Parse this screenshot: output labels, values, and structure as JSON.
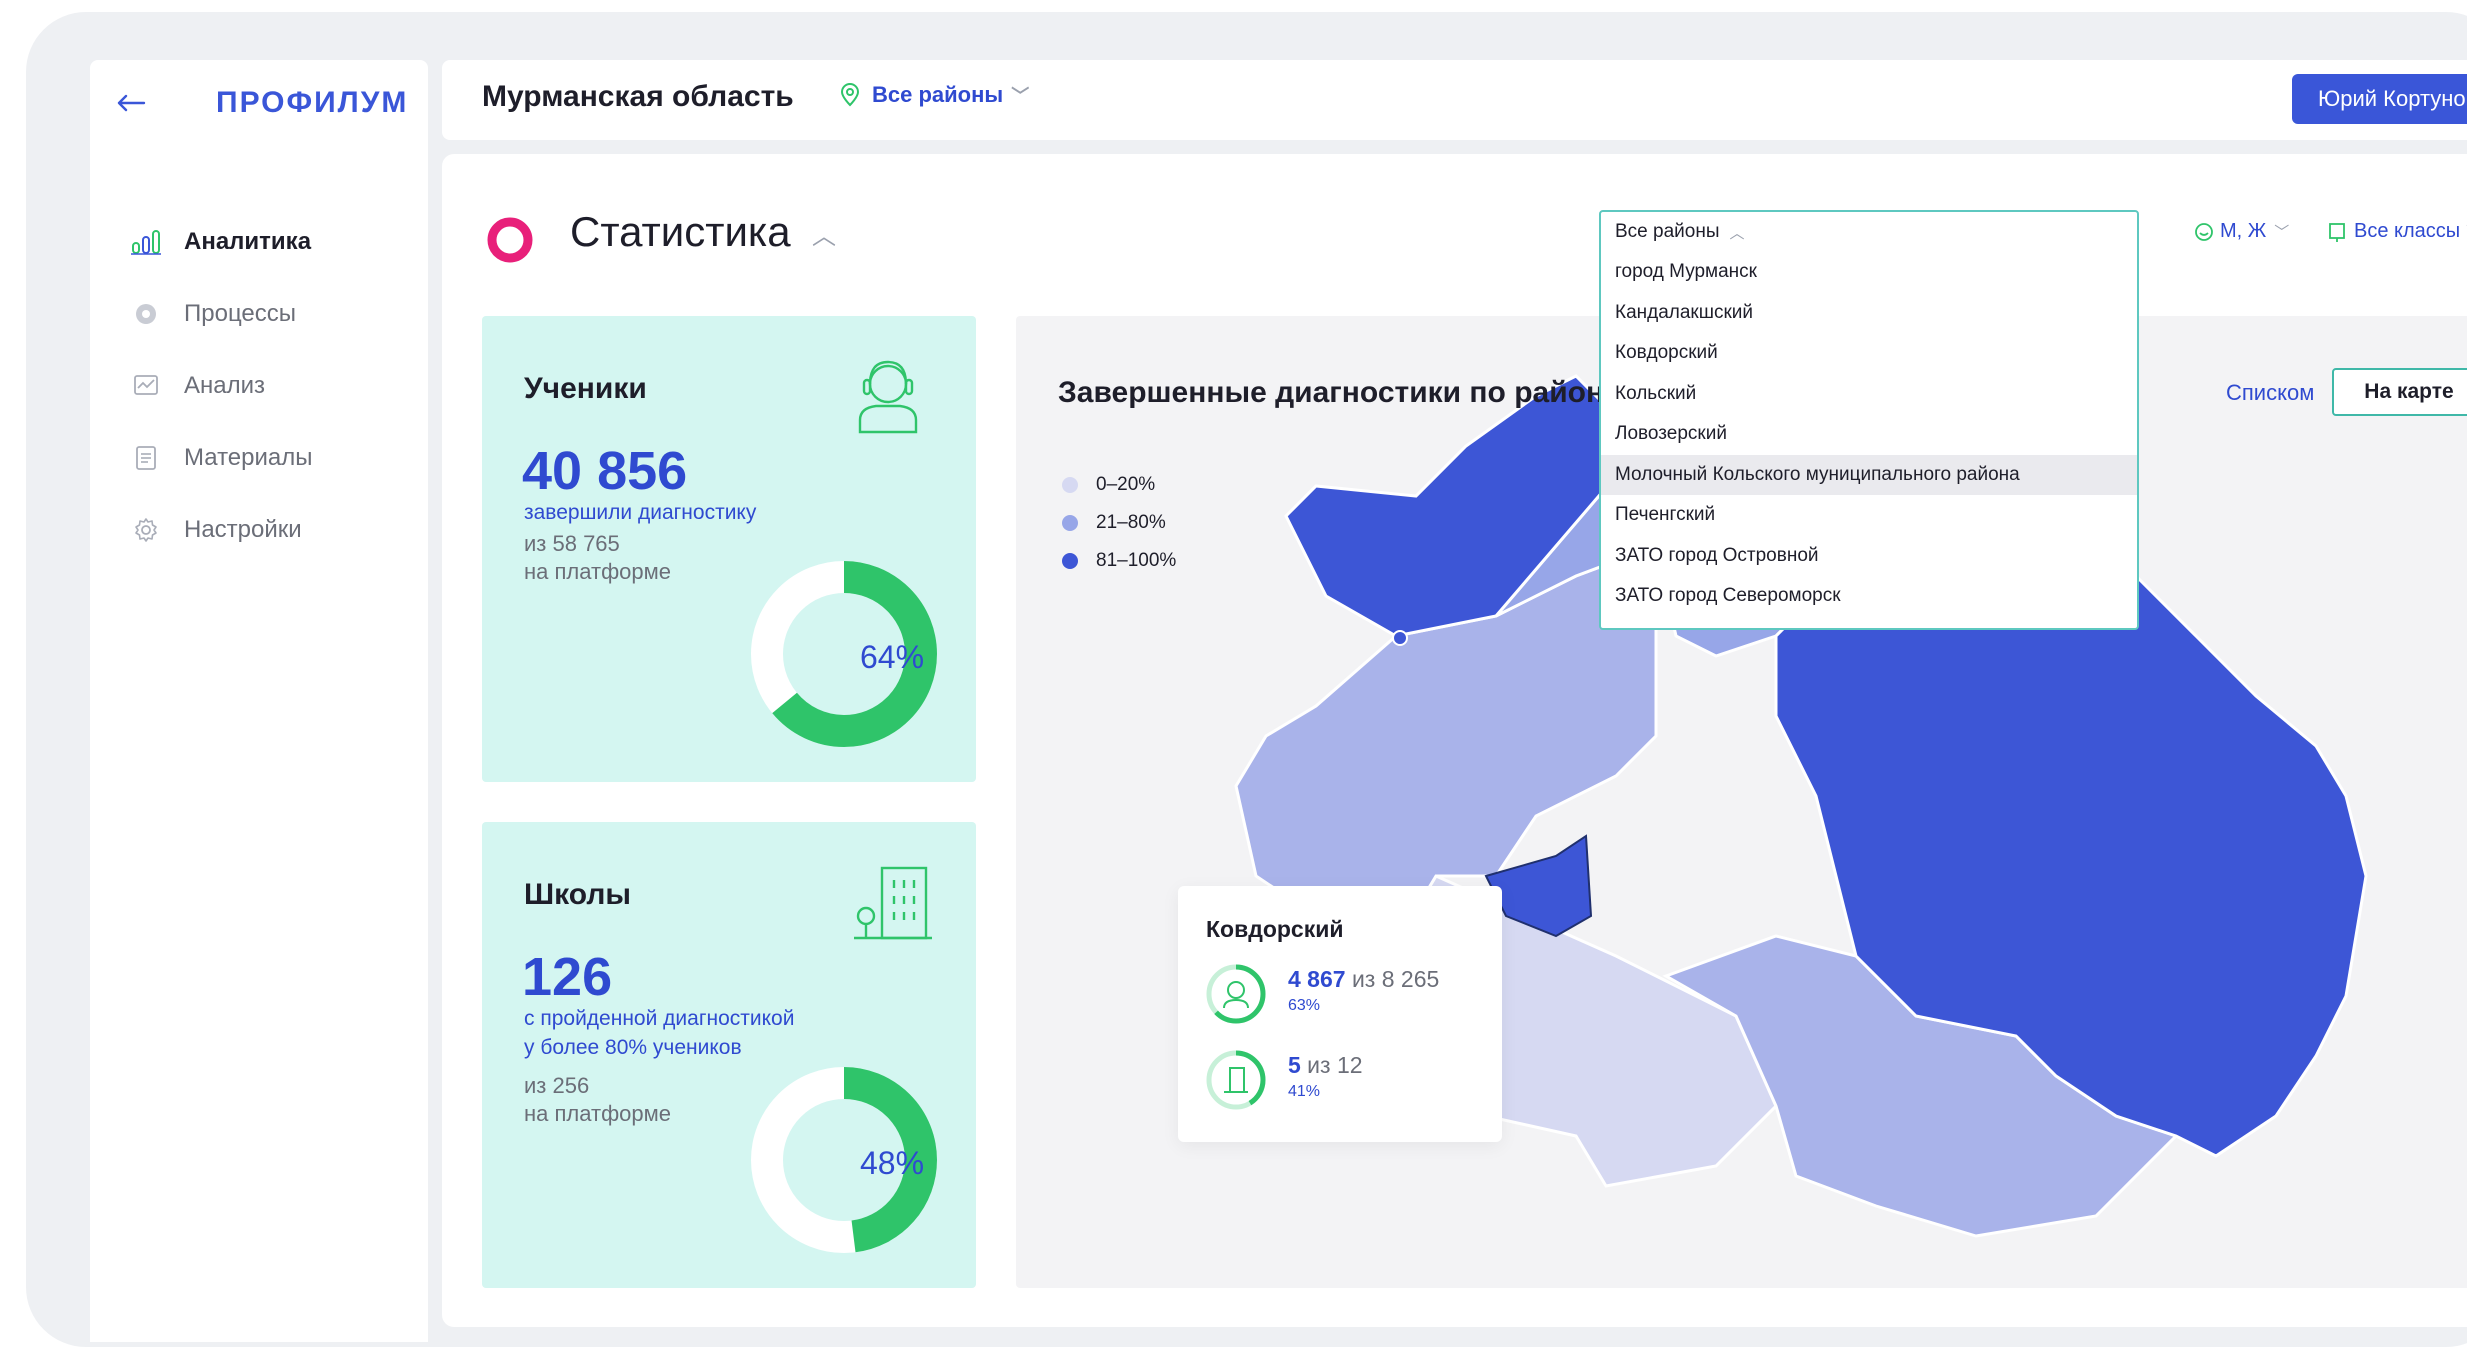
{
  "sidebar": {
    "logo": "ПРОФИЛУМ",
    "items": [
      {
        "label": "Аналитика",
        "icon": "bar-chart-icon",
        "active": true
      },
      {
        "label": "Процессы",
        "icon": "process-icon",
        "active": false
      },
      {
        "label": "Анализ",
        "icon": "analysis-icon",
        "active": false
      },
      {
        "label": "Материалы",
        "icon": "document-icon",
        "active": false
      },
      {
        "label": "Настройки",
        "icon": "gear-icon",
        "active": false
      }
    ]
  },
  "header": {
    "region": "Мурманская область",
    "district_filter": "Все районы",
    "user": "Юрий Кортунов"
  },
  "main": {
    "title": "Статистика",
    "filters": {
      "gender": "М, Ж",
      "classes": "Все классы"
    }
  },
  "students_card": {
    "title": "Ученики",
    "value": "40 856",
    "subtitle": "завершили диагностику",
    "from_line1": "из 58 765",
    "from_line2": "на платформе",
    "percent": 64,
    "percent_label": "64%"
  },
  "schools_card": {
    "title": "Школы",
    "value": "126",
    "subtitle_line1": "с пройденной диагностикой",
    "subtitle_line2": "у более 80% учеников",
    "from_line1": "из 256",
    "from_line2": "на платформе",
    "percent": 48,
    "percent_label": "48%"
  },
  "map": {
    "title": "Завершенные диагностики по районам",
    "view_list": "Списком",
    "view_map": "На карте",
    "legend": [
      {
        "label": "0–20%",
        "color": "#d6d9f2"
      },
      {
        "label": "21–80%",
        "color": "#97a6e8"
      },
      {
        "label": "81–100%",
        "color": "#3d56d6"
      }
    ],
    "tooltip": {
      "name": "Ковдорский",
      "students_value": "4 867",
      "students_of": " из 8 265",
      "students_pct": "63%",
      "schools_value": "5",
      "schools_of": " из 12",
      "schools_pct": "41%"
    }
  },
  "dropdown": {
    "header": "Все районы",
    "items": [
      "город Мурманск",
      "Кандалакшский",
      "Ковдорский",
      "Кольский",
      "Ловозерский",
      "Молочный Кольского муниципального района",
      "Печенгский",
      "ЗАТО город Островной",
      "ЗАТО город Североморск"
    ],
    "highlighted_index": 5
  },
  "colors": {
    "accent": "#3a56d8",
    "green": "#2fc46a",
    "card_bg": "#d4f6f1",
    "brand_ring": "#e8207a"
  }
}
